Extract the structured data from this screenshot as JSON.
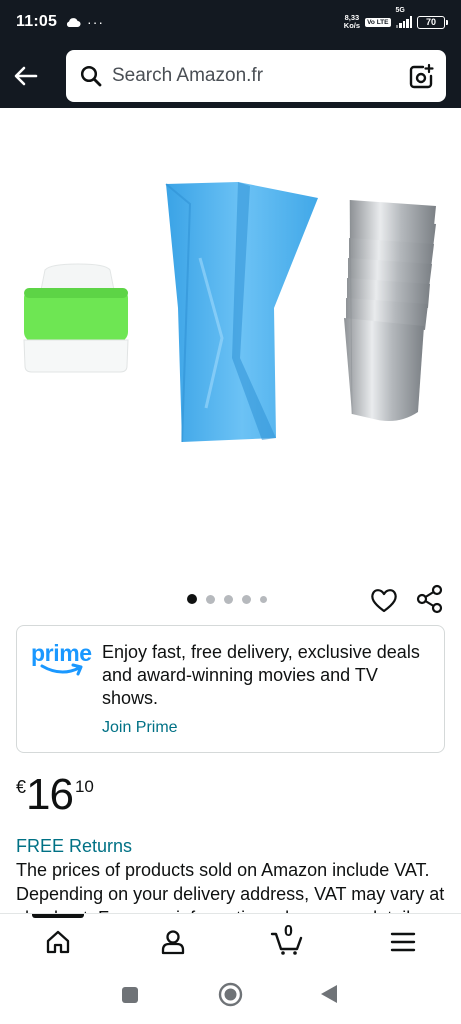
{
  "status_bar": {
    "time": "11:05",
    "dots": "···",
    "net_speed_value": "8,33",
    "net_speed_unit": "Ko/s",
    "volte": "Vo LTE",
    "network": "5G",
    "battery": "70",
    "icons": [
      "cloud-icon",
      "signal-icon",
      "battery-icon"
    ]
  },
  "header": {
    "back_icon": "arrow-left-icon",
    "search_placeholder": "Search Amazon.fr",
    "search_icon": "search-icon",
    "camera_icon": "camera-search-icon"
  },
  "product": {
    "image_items": [
      "coupler",
      "piping-bag",
      "nozzle-stack"
    ],
    "carousel": {
      "count": 5,
      "active_index": 0
    },
    "actions": [
      "heart-icon",
      "share-icon"
    ]
  },
  "prime_card": {
    "logo_text": "prime",
    "message": "Enjoy fast, free delivery, exclusive deals and award-winning movies and TV shows.",
    "link": "Join Prime"
  },
  "price": {
    "symbol": "€",
    "whole": "16",
    "fraction": "10"
  },
  "returns": {
    "label": "FREE Returns",
    "vat_text": "The prices of products sold on Amazon include VAT. Depending on your delivery address, VAT may vary at checkout. For more information, please see details."
  },
  "bottom_nav": {
    "items": [
      "home-icon",
      "account-icon",
      "cart-icon",
      "menu-icon"
    ],
    "cart_count": "0"
  },
  "system_nav": {
    "buttons": [
      "recents-button",
      "home-button",
      "back-button"
    ]
  },
  "colors": {
    "header_bg": "#131921",
    "link": "#007185",
    "prime_blue": "#1a98ff",
    "text": "#0f1111"
  }
}
